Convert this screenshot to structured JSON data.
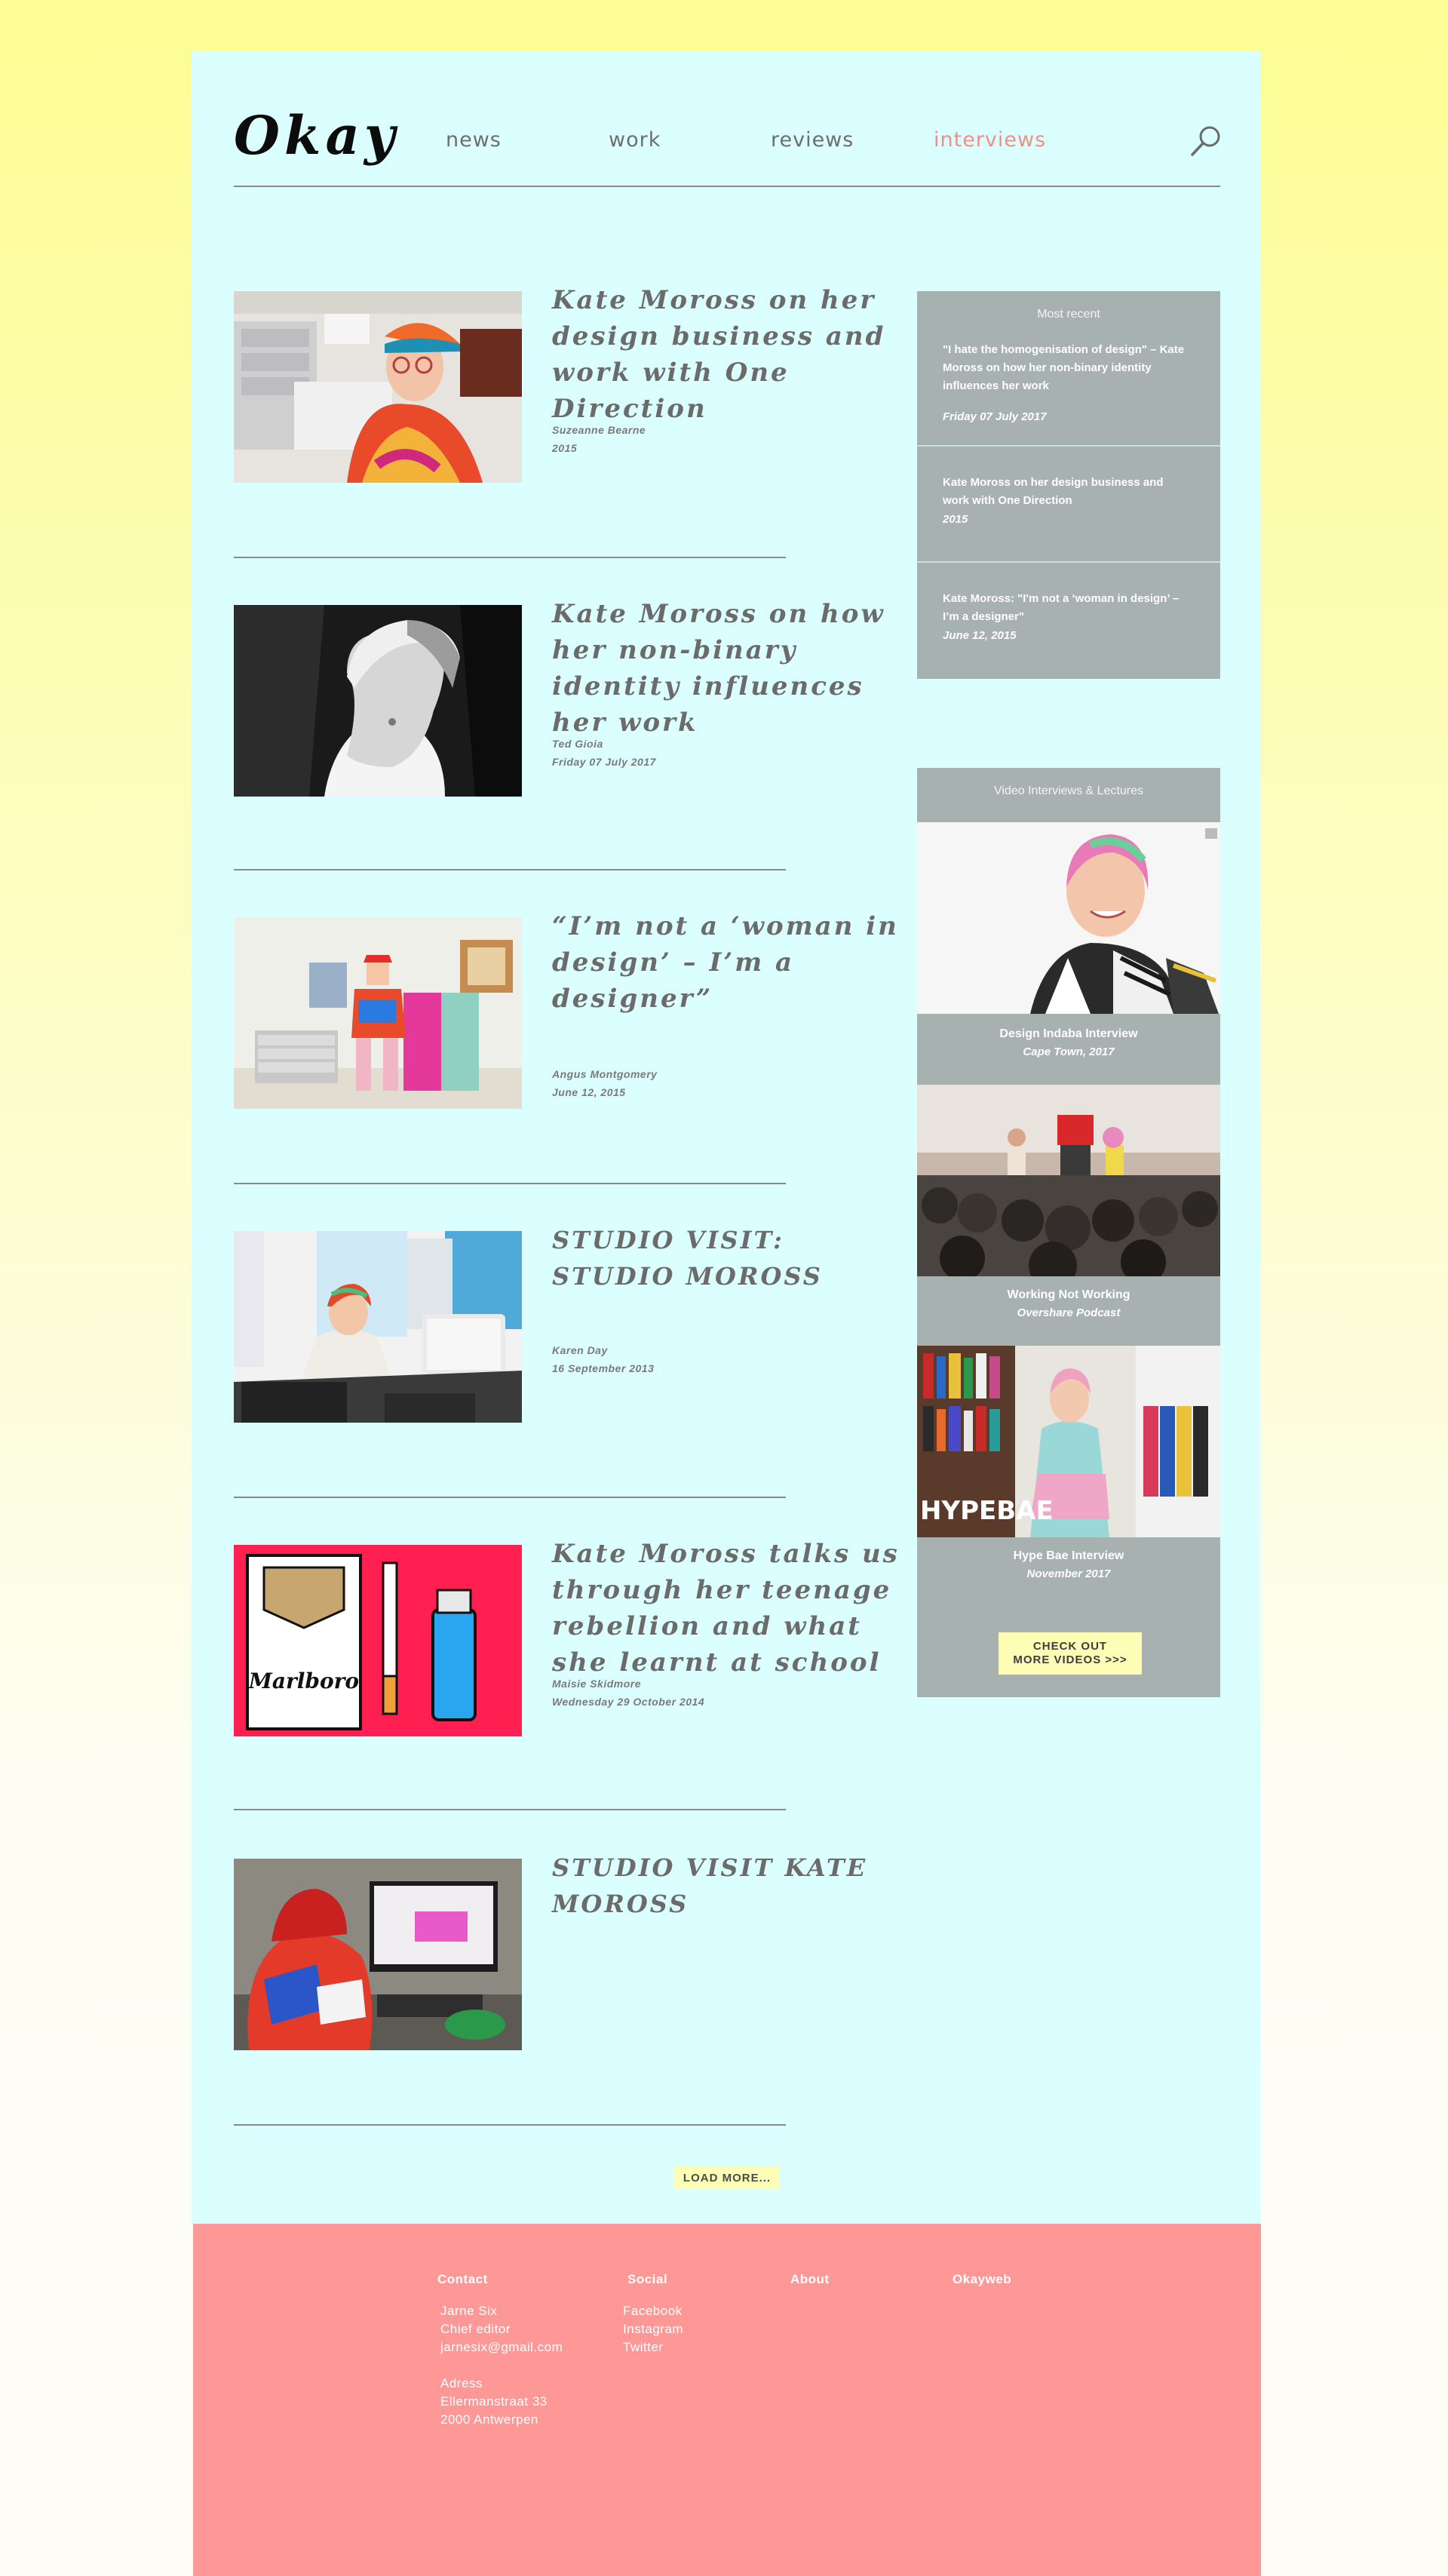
{
  "header": {
    "logo": "Okay",
    "nav": [
      "news",
      "work",
      "reviews",
      "interviews"
    ]
  },
  "articles": [
    {
      "title": "Kate Moross on her design business and work with One Direction",
      "author": "Suzeanne Bearne",
      "date": "2015"
    },
    {
      "title": "Kate Moross on how her non-binary identity influences her work",
      "author": "Ted Gioia",
      "date": "Friday 07 July 2017"
    },
    {
      "title": "“I’m not a ‘woman in design’ – I’m a designer”",
      "author": "Angus Montgomery",
      "date": "June 12, 2015"
    },
    {
      "title": "STUDIO VISIT: STUDIO MOROSS",
      "author": "Karen Day",
      "date": "16 September 2013"
    },
    {
      "title": "Kate Moross talks us through her teenage rebellion and what she learnt at school",
      "author": "Maisie Skidmore",
      "date": "Wednesday 29 October 2014"
    },
    {
      "title": "STUDIO VISIT KATE MOROSS",
      "author": "",
      "date": ""
    }
  ],
  "load_more_label": "LOAD MORE...",
  "sidebar": {
    "most_recent_heading": "Most recent",
    "most_recent": [
      {
        "title": "\"I hate the homogenisation of design\" – Kate Moross on how her non-binary identity influences her work",
        "date": "Friday 07 July 2017"
      },
      {
        "title": "Kate Moross on her design business and work with One Direction",
        "date": "2015"
      },
      {
        "title": "Kate Moross: \"I'm not a ‘woman in design’ – I’m a designer\"",
        "date": "June 12, 2015"
      }
    ],
    "videos_heading": "Video Interviews & Lectures",
    "videos": [
      {
        "title": "Design Indaba Interview",
        "subtitle": "Cape Town, 2017"
      },
      {
        "title": "Working Not Working",
        "subtitle": "Overshare Podcast"
      },
      {
        "title": "Hype Bae Interview",
        "subtitle": "November 2017"
      }
    ],
    "cta_line1": "CHECK OUT",
    "cta_line2": "MORE VIDEOS >>>",
    "hypebae_overlay": "HYPEBAE"
  },
  "footer": {
    "contact_heading": "Contact",
    "contact_lines": [
      "Jarne Six",
      "Chief editor",
      "jarnesix@gmail.com"
    ],
    "address_lines": [
      "Adress",
      "Ellermanstraat 33",
      "2000 Antwerpen"
    ],
    "social_heading": "Social",
    "social_links": [
      "Facebook",
      "Instagram",
      "Twitter"
    ],
    "about_heading": "About",
    "okayweb_heading": "Okayweb"
  },
  "thumb_text": {
    "marlboro": "Marlboro"
  },
  "colors": {
    "page_bg": "#dafffe",
    "accent_active": "#f28e87",
    "sidebar_bg": "#a7b1af",
    "footer_bg": "#fe9897",
    "button_bg": "#fdfdb6"
  }
}
